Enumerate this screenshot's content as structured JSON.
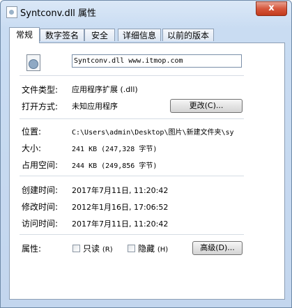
{
  "window": {
    "title": "Syntconv.dll 属性",
    "close_label": "x"
  },
  "tabs": [
    {
      "label": "常规",
      "active": true
    },
    {
      "label": "数字签名"
    },
    {
      "label": "安全"
    },
    {
      "label": "详细信息"
    },
    {
      "label": "以前的版本"
    }
  ],
  "general": {
    "file_name": "Syntconv.dll www.itmop.com",
    "file_type_label": "文件类型:",
    "file_type_value": "应用程序扩展 (.dll)",
    "open_with_label": "打开方式:",
    "open_with_value": "未知应用程序",
    "change_button": "更改(C)...",
    "location_label": "位置:",
    "location_value": "C:\\Users\\admin\\Desktop\\图片\\新建文件夹\\sy",
    "size_label": "大小:",
    "size_value": "241 KB (247,328 字节)",
    "size_on_disk_label": "占用空间:",
    "size_on_disk_value": "244 KB (249,856 字节)",
    "created_label": "创建时间:",
    "created_value": "2017年7月11日, 11:20:42",
    "modified_label": "修改时间:",
    "modified_value": "2012年1月16日, 17:06:52",
    "accessed_label": "访问时间:",
    "accessed_value": "2017年7月11日, 11:20:42",
    "attributes_label": "属性:",
    "readonly_label": "只读",
    "readonly_key": "(R)",
    "hidden_label": "隐藏",
    "hidden_key": "(H)",
    "advanced_button": "高级(D)..."
  },
  "colors": {
    "frame": "#c9dcf2",
    "close": "#c23a1c"
  }
}
